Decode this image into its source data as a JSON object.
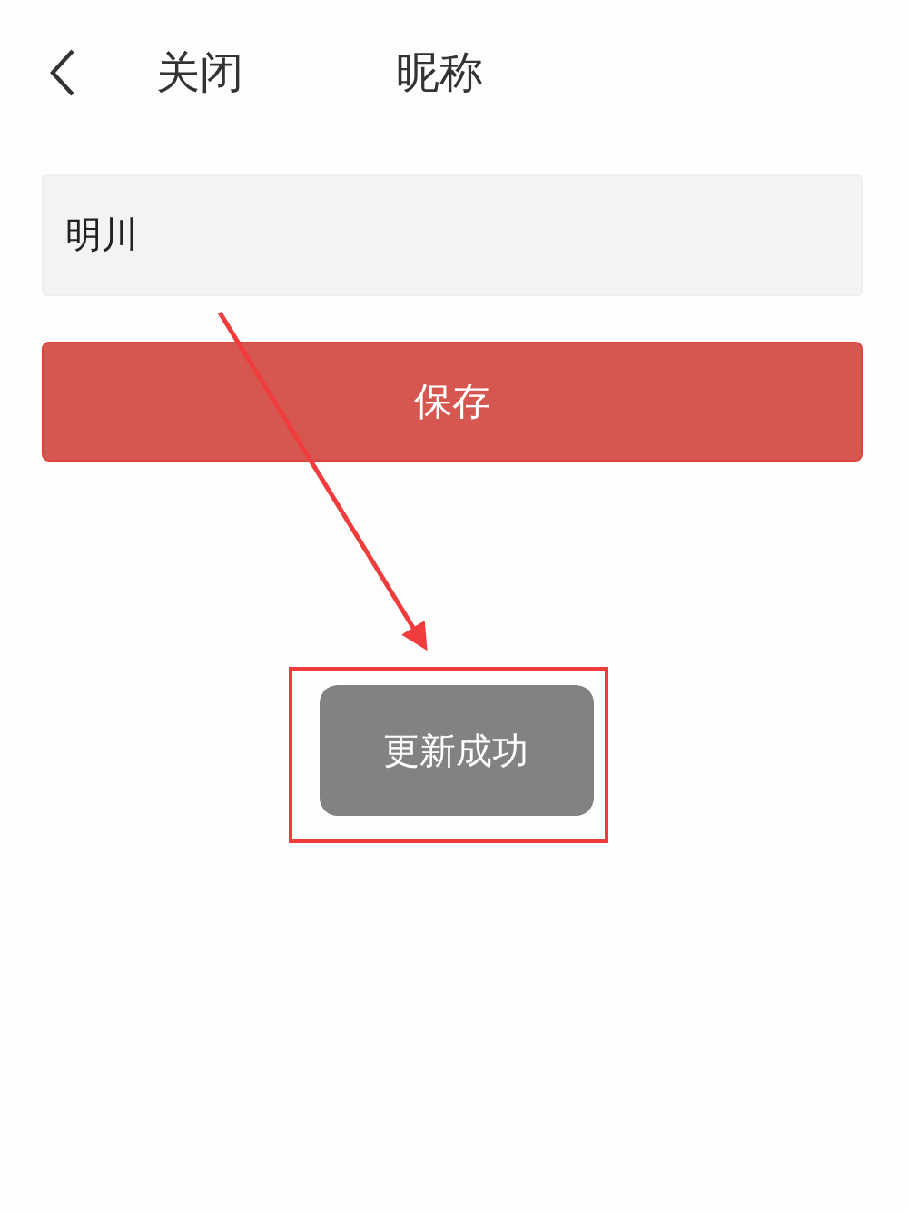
{
  "header": {
    "close_label": "关闭",
    "title": "昵称"
  },
  "nickname_field": {
    "value": "明川"
  },
  "save_button": {
    "label": "保存"
  },
  "toast": {
    "message": "更新成功"
  }
}
